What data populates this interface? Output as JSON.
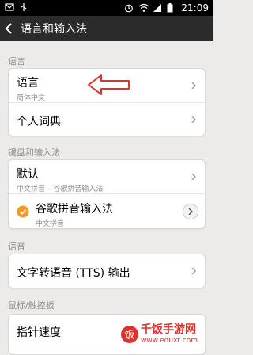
{
  "status": {
    "time": "21:09"
  },
  "header": {
    "title": "语言和输入法"
  },
  "sections": {
    "language": "语言",
    "keyboard": "键盘和输入法",
    "voice": "语音",
    "pointer": "鼠标/触控板"
  },
  "language_card": {
    "language": {
      "label": "语言",
      "value": "简体中文"
    },
    "dictionary": {
      "label": "个人词典"
    }
  },
  "keyboard_card": {
    "default": {
      "label": "默认",
      "value": "中文拼音 – 谷歌拼音输入法"
    },
    "ime": {
      "label": "谷歌拼音输入法",
      "value": "中文拼音",
      "checked": true
    }
  },
  "voice_card": {
    "tts": {
      "label": "文字转语音 (TTS) 输出"
    }
  },
  "pointer_card": {
    "speed": {
      "label": "指针速度"
    }
  },
  "watermark": {
    "name": "千饭手游网",
    "url": "www.eduxt.com"
  }
}
